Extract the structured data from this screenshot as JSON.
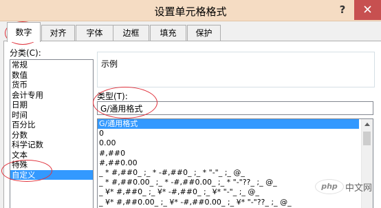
{
  "window": {
    "title": "设置单元格格式",
    "help_symbol": "?"
  },
  "tabs": [
    {
      "label": "数字",
      "active": true
    },
    {
      "label": "对齐",
      "active": false
    },
    {
      "label": "字体",
      "active": false
    },
    {
      "label": "边框",
      "active": false
    },
    {
      "label": "填充",
      "active": false
    },
    {
      "label": "保护",
      "active": false
    }
  ],
  "category": {
    "label": "分类(C):",
    "items": [
      "常规",
      "数值",
      "货币",
      "会计专用",
      "日期",
      "时间",
      "百分比",
      "分数",
      "科学记数",
      "文本",
      "特殊",
      "自定义"
    ],
    "selected": "自定义"
  },
  "sample": {
    "label": "示例"
  },
  "type": {
    "label": "类型(T):",
    "value": "G/通用格式"
  },
  "format_list": {
    "items": [
      "G/通用格式",
      "0",
      "0.00",
      "#,##0",
      "#,##0.00",
      "_ * #,##0_ ;_ * -#,##0_ ;_ * \"-\"_ ;_ @_",
      "_ * #,##0.00_ ;_ * -#,##0.00_ ;_ * \"-\"??_ ;_ @_",
      "_ ¥* #,##0_ ;_ ¥* -#,##0_ ;_ ¥* \"-\"_ ;_ @_",
      "_ ¥* #,##0.00_ ;_ ¥* -#,##0.00_ ;_ ¥* \"-\"??_ ;_ @_"
    ],
    "selected": "G/通用格式"
  },
  "watermark": {
    "logo_text": "php",
    "site_text": "中文网"
  },
  "colors": {
    "titlebar": "#f5dcc3",
    "close_button": "#c75050",
    "selection": "#3399ff",
    "annotation": "#e0303a"
  }
}
